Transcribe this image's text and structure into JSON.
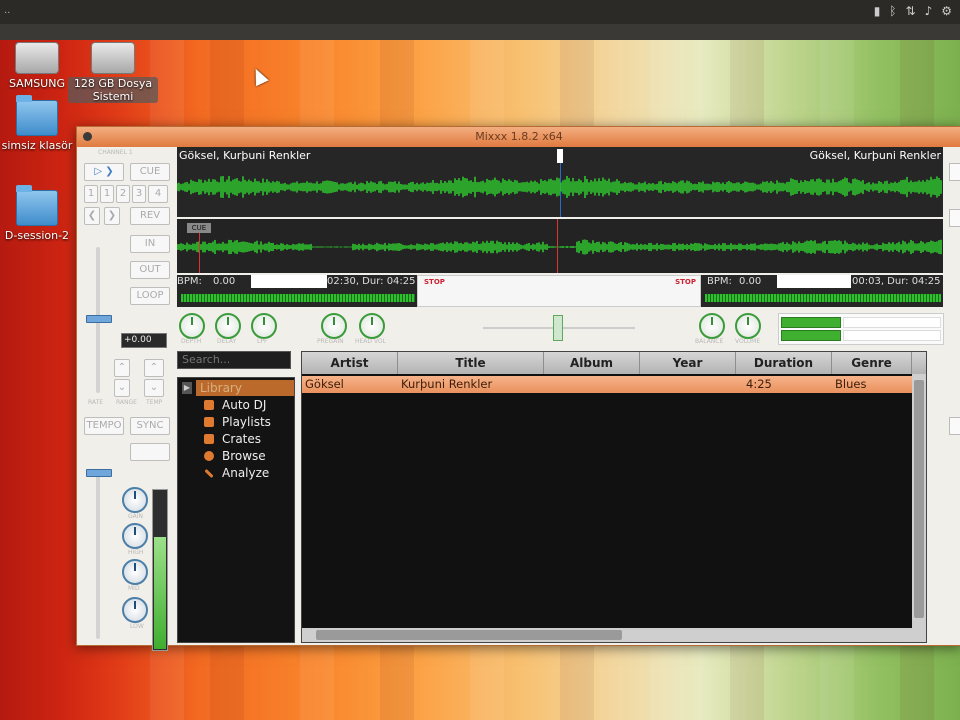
{
  "topbar": {
    "left": "..",
    "tray_icons": [
      "battery-icon",
      "bluetooth-icon",
      "network-icon",
      "volume-icon",
      "gear-icon"
    ]
  },
  "desktop": {
    "icons": [
      {
        "label": "SAMSUNG",
        "icon": "usb-drive-icon"
      },
      {
        "label": "128 GB Dosya Sistemi",
        "icon": "hard-drive-icon"
      },
      {
        "label": "simsiz klasör",
        "icon": "folder-icon"
      },
      {
        "label": "D-session-2",
        "icon": "folder-icon"
      }
    ]
  },
  "window": {
    "title": "Mixxx 1.8.2 x64"
  },
  "deck_left": {
    "channel_label": "CHANNEL 1",
    "cue": "CUE",
    "rev": "REV",
    "in": "IN",
    "out": "OUT",
    "loop": "LOOP",
    "pitch_value": "+0.00",
    "tempo_label": "TEMPO",
    "sync": "SYNC",
    "small_labels": [
      "RATE",
      "RANGE",
      "TEMP"
    ],
    "eq_labels": [
      "GAIN",
      "HIGH",
      "MID",
      "LOW"
    ]
  },
  "overview": {
    "track_left": "Göksel, Kurþuni Renkler",
    "track_right": "Göksel, Kurþuni Renkler"
  },
  "bpm": {
    "left_bpm_label": "BPM:",
    "left_bpm_value": "0.00",
    "left_time": "02:30, Dur: 04:25",
    "right_bpm_label": "BPM:",
    "right_bpm_value": "0.00",
    "right_time": "00:03, Dur: 04:25",
    "stop_label": "STOP"
  },
  "mixer": {
    "knob_labels": [
      "DEPTH",
      "DELAY",
      "LPF",
      "PREGAIN",
      "HEAD VOL",
      "BALANCE",
      "VOLUME"
    ]
  },
  "library": {
    "search_placeholder": "Search...",
    "sidebar": [
      {
        "label": "Library",
        "icon": "library-icon"
      },
      {
        "label": "Auto DJ",
        "icon": "auto-dj-icon"
      },
      {
        "label": "Playlists",
        "icon": "playlist-icon"
      },
      {
        "label": "Crates",
        "icon": "crate-icon"
      },
      {
        "label": "Browse",
        "icon": "search-icon"
      },
      {
        "label": "Analyze",
        "icon": "analyze-icon"
      }
    ],
    "columns": [
      "Artist",
      "Title",
      "Album",
      "Year",
      "Duration",
      "Genre"
    ],
    "rows": [
      {
        "artist": "Göksel",
        "title": "Kurþuni Renkler",
        "album": "",
        "year": "",
        "duration": "4:25",
        "genre": "Blues"
      }
    ]
  },
  "colors": {
    "accent_orange": "#e07a30",
    "waveform_green": "#2fbf2f",
    "selected_row": "#f0a070"
  }
}
